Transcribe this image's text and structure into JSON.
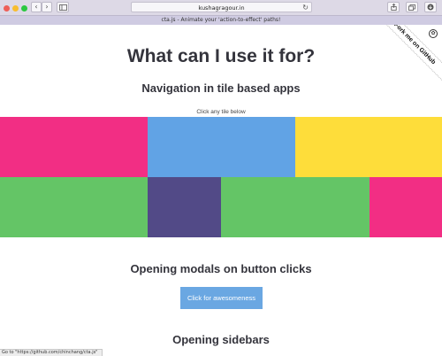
{
  "browser": {
    "url": "kushagragour.in",
    "tab_title": "cta.js - Animate your 'action-to-effect' paths!",
    "back_icon": "chevron-left-icon",
    "forward_icon": "chevron-right-icon",
    "sidebar_icon": "sidebar-icon",
    "reload_icon": "reload-icon",
    "share_icon": "share-icon",
    "tabs_icon": "tabs-icon",
    "download_icon": "download-icon"
  },
  "ribbon": {
    "label": "Fork me on GitHub"
  },
  "page": {
    "title": "What can I use it for?",
    "section_tiles": "Navigation in tile based apps",
    "tiles_hint": "Click any tile below",
    "tile_colors": [
      "#f22e84",
      "#61a3e5",
      "#fedd3a",
      "#64c566",
      "#524a87",
      "#64c566",
      "#f22e84"
    ],
    "section_modals": "Opening modals on button clicks",
    "modal_button": "Click for awesomeness",
    "section_sidebars": "Opening sidebars"
  },
  "status_bar": {
    "text": "Go to \"https://github.com/chinchang/cta.js\""
  }
}
